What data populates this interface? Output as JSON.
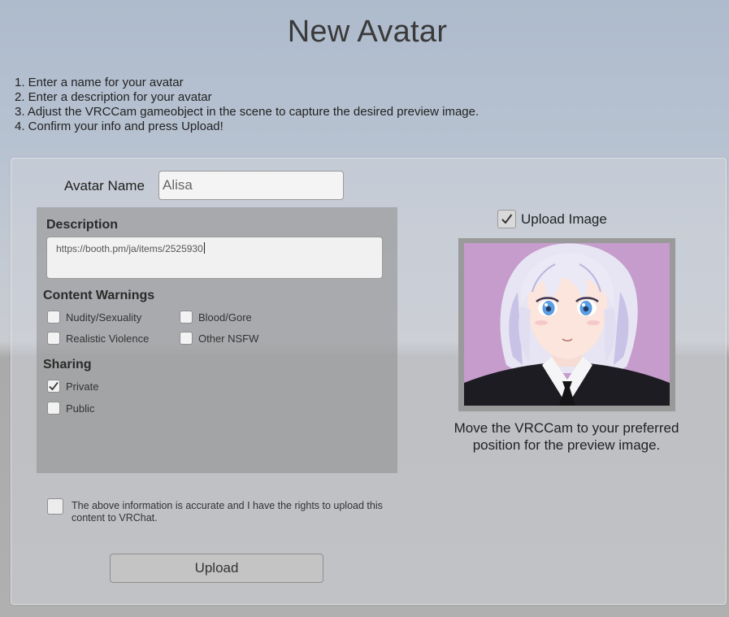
{
  "title": "New Avatar",
  "instructions": [
    "1. Enter a name for your avatar",
    "2. Enter a description for your avatar",
    "3. Adjust the VRCCam gameobject in the scene to capture the desired preview image.",
    "4. Confirm your info and press Upload!"
  ],
  "avatar_name": {
    "label": "Avatar Name",
    "value": "Alisa"
  },
  "description": {
    "title": "Description",
    "value": "https://booth.pm/ja/items/2525930"
  },
  "content_warnings": {
    "title": "Content Warnings",
    "options": [
      {
        "label": "Nudity/Sexuality",
        "checked": false
      },
      {
        "label": "Blood/Gore",
        "checked": false
      },
      {
        "label": "Realistic Violence",
        "checked": false
      },
      {
        "label": "Other NSFW",
        "checked": false
      }
    ]
  },
  "sharing": {
    "title": "Sharing",
    "options": [
      {
        "label": "Private",
        "checked": true
      },
      {
        "label": "Public",
        "checked": false
      }
    ]
  },
  "upload_image": {
    "label": "Upload Image",
    "checked": true
  },
  "preview_caption": "Move the VRCCam to your preferred position for the preview image.",
  "confirm": {
    "text": "The above information is accurate and I have the rights to upload this content to VRChat.",
    "checked": false
  },
  "upload_button": "Upload",
  "colors": {
    "preview_background": "#c59ccc",
    "hair": "#e8e6f4",
    "suit": "#1c1c22"
  }
}
